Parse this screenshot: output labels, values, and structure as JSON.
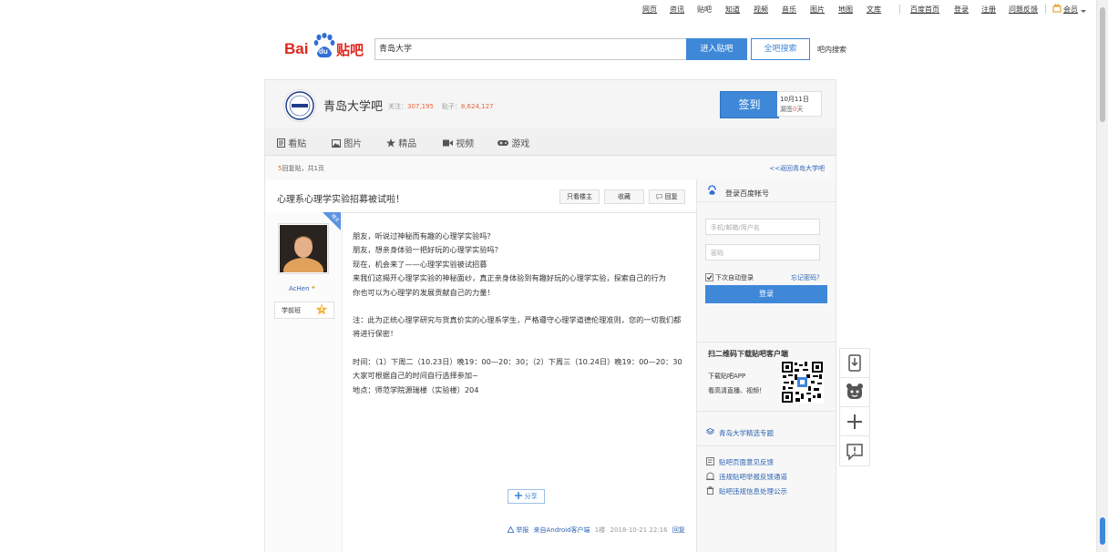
{
  "topnav": {
    "links": [
      "网页",
      "资讯",
      "贴吧",
      "知道",
      "视频",
      "音乐",
      "图片",
      "地图",
      "文库"
    ],
    "current": "贴吧",
    "right_links": [
      "百度首页",
      "登录",
      "注册",
      "问题反馈"
    ],
    "member": "会员"
  },
  "search": {
    "value": "青岛大学",
    "enter_label": "进入贴吧",
    "fullsearch_label": "全吧搜索",
    "advanced_label": "吧内搜索"
  },
  "logo": {
    "text_left": "Bai",
    "text_mid": "du",
    "text_right": "贴吧"
  },
  "forum": {
    "name": "青岛大学吧",
    "follow_label": "关注：",
    "follow_count": "307,195",
    "posts_label": "贴子：",
    "posts_count": "8,624,127",
    "signin_label": "签到",
    "signin_date": "10月11日",
    "signin_streak_prefix": "漏签",
    "signin_streak_num": "0",
    "signin_streak_suffix": "天",
    "avatar_text": "青岛大学"
  },
  "tabs": [
    {
      "label": "看贴",
      "icon": "document-icon"
    },
    {
      "label": "图片",
      "icon": "image-icon"
    },
    {
      "label": "精品",
      "icon": "star-icon"
    },
    {
      "label": "视频",
      "icon": "video-icon"
    },
    {
      "label": "游戏",
      "icon": "gamepad-icon"
    }
  ],
  "subbar": {
    "reply_count": "5",
    "reply_text": "回复贴，共1页",
    "back_link": "<<返回青岛大学吧"
  },
  "post": {
    "title": "心理系心理学实验招募被试啦！",
    "only_op_label": "只看楼主",
    "collect_label": "收藏",
    "reply_label": "回复",
    "badge": "楼主",
    "author_name": "AcHen",
    "level_name": "学前班",
    "level_num": "1",
    "body": [
      "朋友，听说过神秘而有趣的心理学实验吗？",
      "朋友，想亲身体验一把好玩的心理学实验吗？",
      "现在，机会来了——心理学实验被试招募",
      "来我们这揭开心理学实验的神秘面纱，真正亲身体验到有趣好玩的心理学实验，探索自己的行为",
      "你也可以为心理学的发展贡献自己的力量！",
      "",
      "注：此为正统心理学研究与货真价实的心理系学生，严格遵守心理学道德伦理准则，您的一切我们都将进行保密！",
      "",
      "时间：（1）下周二（10.23日）晚19：00—20：30；（2）下周三（10.24日）晚19：00—20：30 大家可根据自己的时间自行选择参加~",
      "地点：师范学院源瑞楼（实验楼）204"
    ],
    "share_label": "分享",
    "report_label": "举报",
    "source": "来自Android客户端",
    "floor": "1楼",
    "datetime": "2018-10-21 22:16",
    "reply_link": "回复"
  },
  "sidebar": {
    "login_title": "登录百度帐号",
    "username_placeholder": "手机/邮箱/用户名",
    "password_placeholder": "密码",
    "remember_label": "下次自动登录",
    "forgot_label": "忘记密码？",
    "login_button": "登录",
    "qr_title": "扫二维码下载贴吧客户端",
    "qr_line1": "下载贴吧APP",
    "qr_line2": "看高清直播、视频！",
    "topic_link": "青岛大学精选专题",
    "links": [
      "贴吧页面意见反馈",
      "违规贴吧举报反馈通道",
      "贴吧违规信息处理公示"
    ]
  },
  "colors": {
    "accent": "#3f88d8",
    "link": "#2d64b3",
    "highlight": "#e8643a"
  }
}
